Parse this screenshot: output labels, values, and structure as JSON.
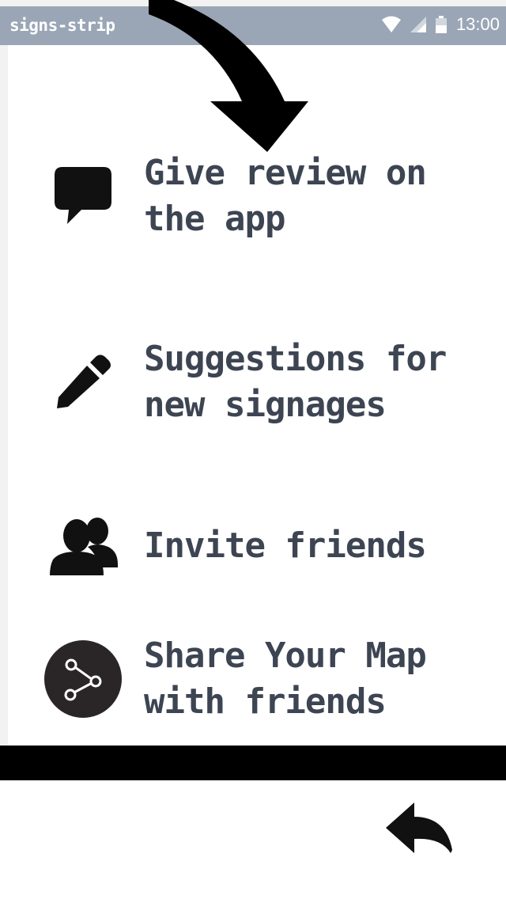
{
  "status_bar": {
    "app_name": "signs-strip",
    "time": "13:00",
    "icons": [
      "wifi-icon",
      "signal-icon",
      "battery-icon"
    ],
    "background": "#9aa6b5"
  },
  "menu": {
    "items": [
      {
        "icon": "chat-bubble-icon",
        "label": "Give review on\nthe app"
      },
      {
        "icon": "pencil-icon",
        "label": "Suggestions for\nnew signages"
      },
      {
        "icon": "friends-icon",
        "label": "Invite friends"
      },
      {
        "icon": "share-icon",
        "label": "Share Your Map\nwith friends"
      }
    ],
    "label_color": "#3d4452"
  },
  "footer": {
    "back_icon": "reply-back-icon"
  }
}
